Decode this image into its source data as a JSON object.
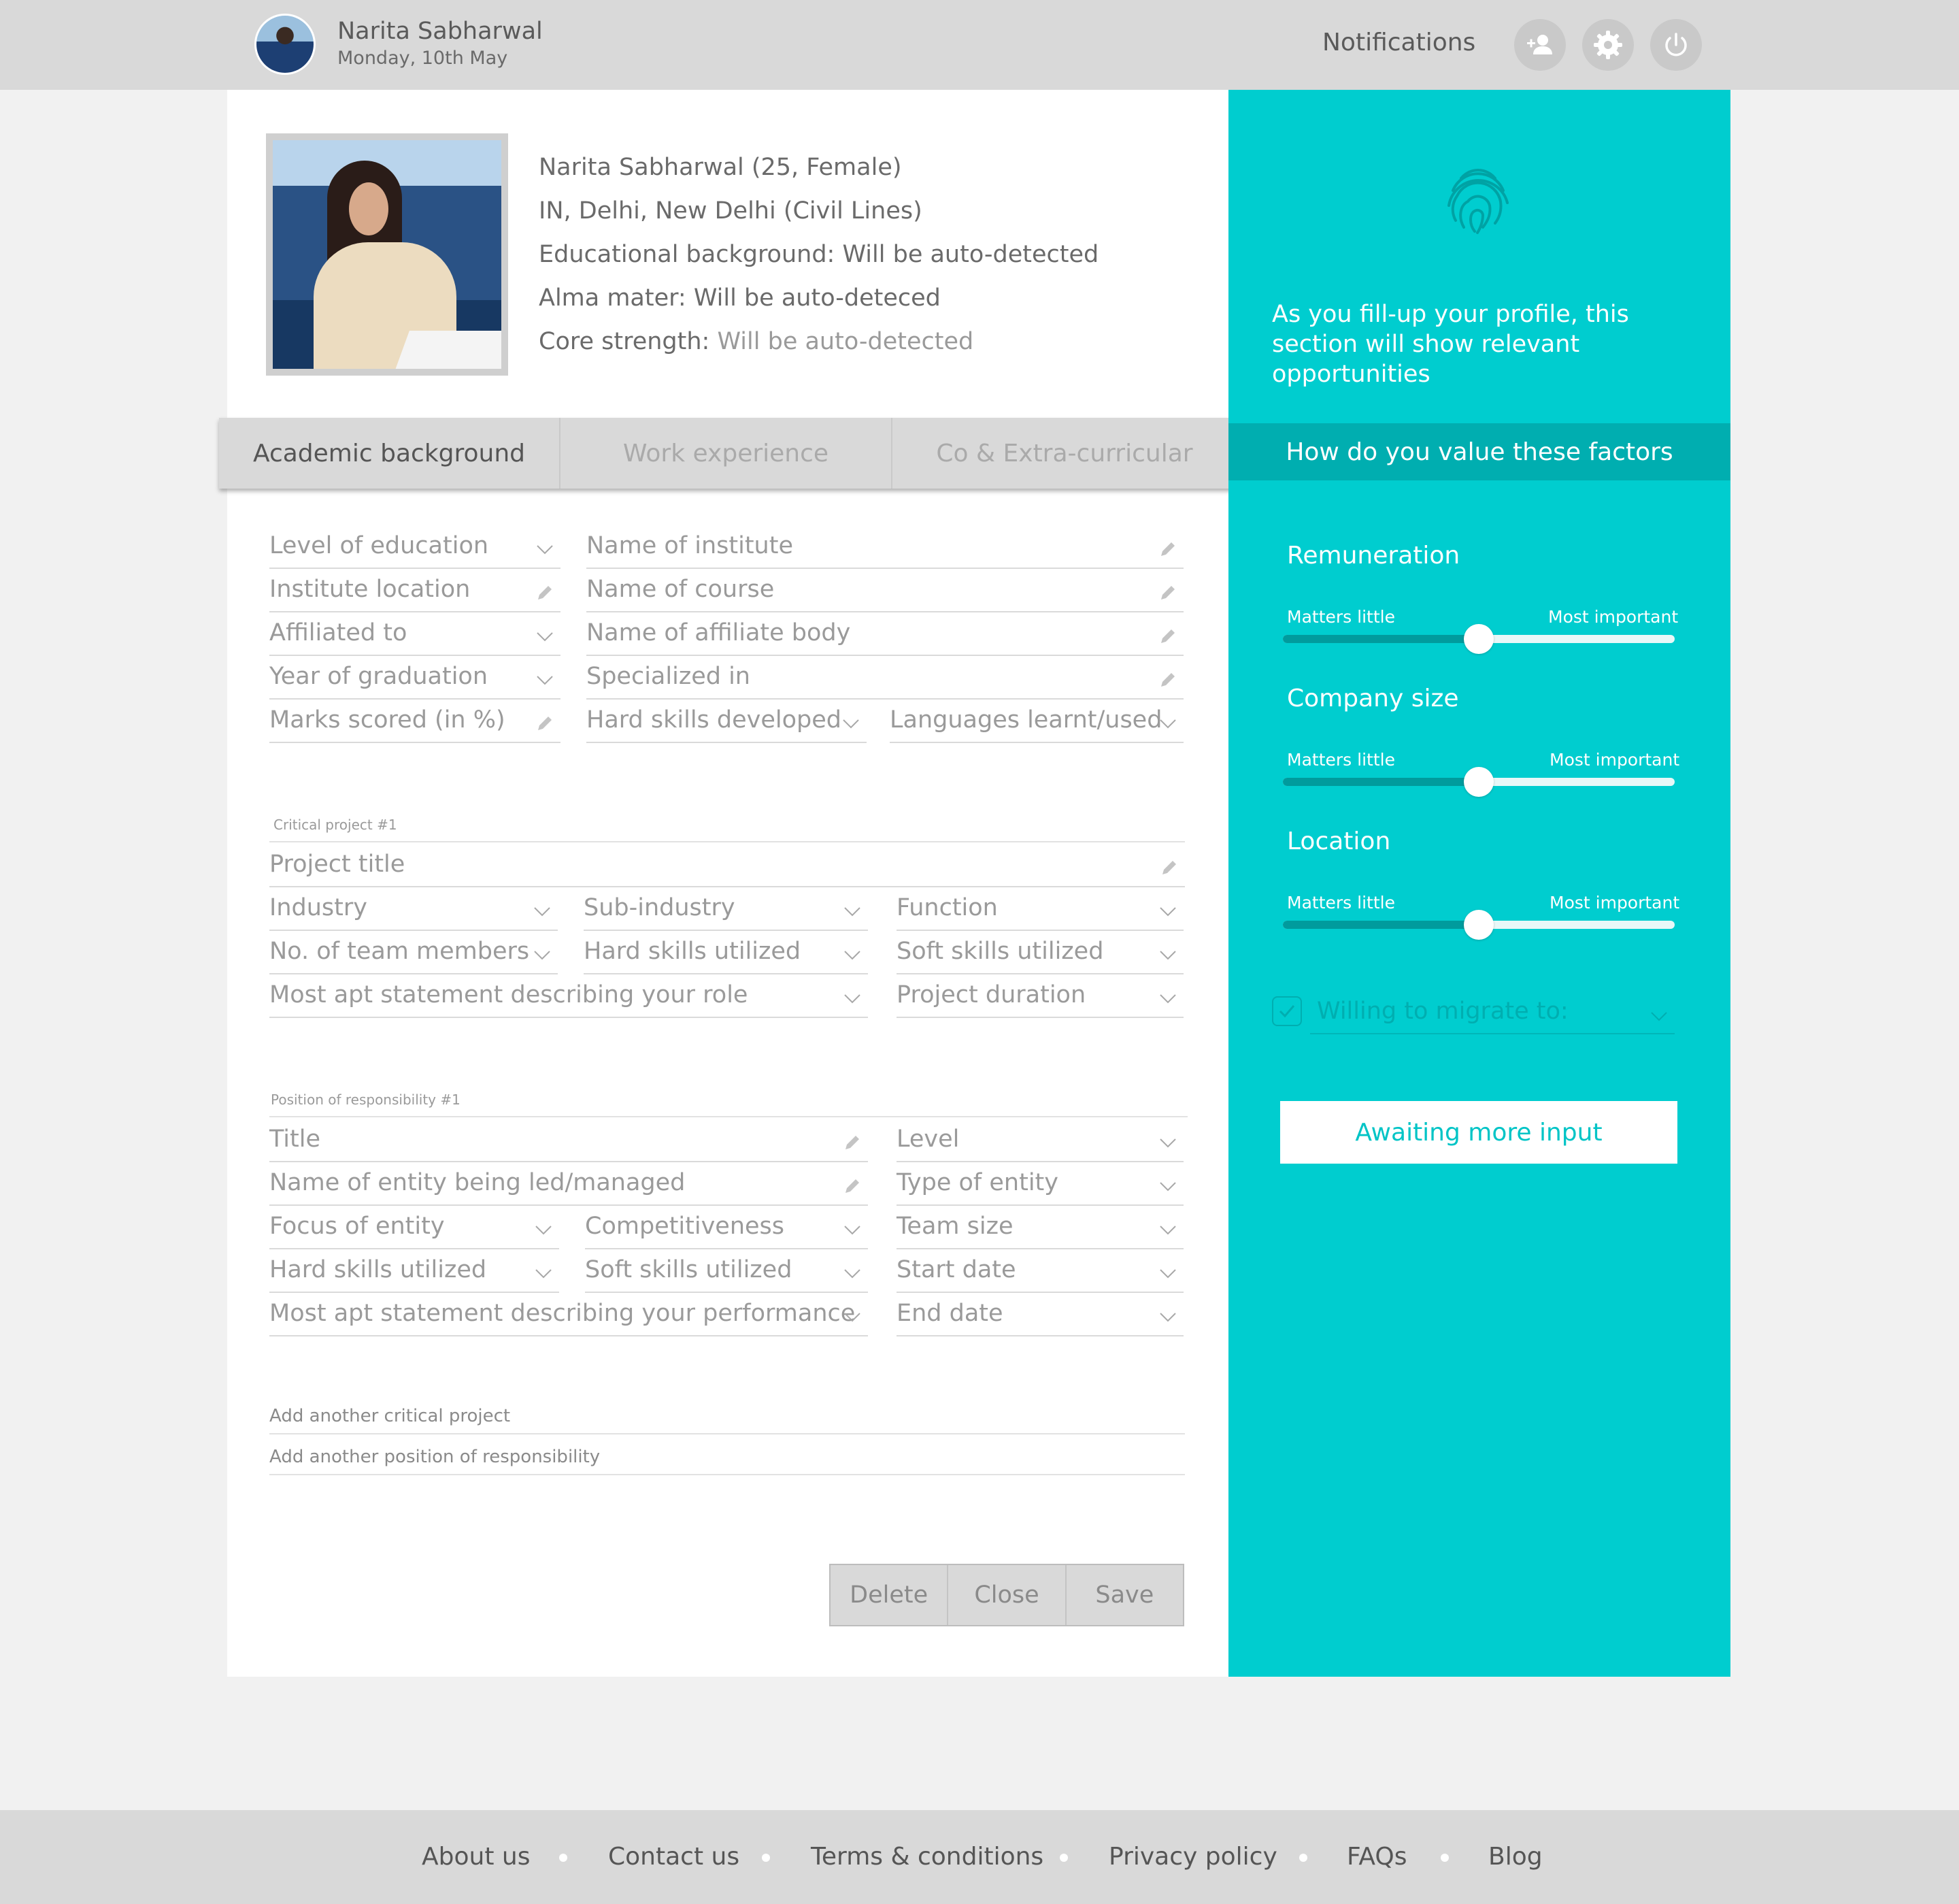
{
  "header": {
    "user_name": "Narita Sabharwal",
    "date": "Monday, 10th May",
    "notifications_label": "Notifications",
    "icons": [
      "add-person-icon",
      "gear-icon",
      "power-icon"
    ]
  },
  "profile": {
    "line1": "Narita Sabharwal (25, Female)",
    "line2": "IN, Delhi, New Delhi (Civil Lines)",
    "line3": "Educational background: Will be auto-detected",
    "line4": "Alma mater: Will be auto-deteced",
    "line5_label": "Core strength: ",
    "line5_value": "Will be auto-detected"
  },
  "tabs": {
    "academic": "Academic background",
    "work": "Work experience",
    "extra": "Co & Extra-curricular"
  },
  "academic": {
    "level_of_education": "Level of education",
    "name_of_institute": "Name of institute",
    "institute_location": "Institute location",
    "name_of_course": "Name of course",
    "affiliated_to": "Affiliated to",
    "name_of_affiliate_body": "Name of affiliate body",
    "year_of_graduation": "Year of graduation",
    "specialized_in": "Specialized in",
    "marks_scored": "Marks scored (in %)",
    "hard_skills_developed": "Hard skills developed",
    "languages": "Languages learnt/used"
  },
  "project": {
    "section_label": "Critical project #1",
    "project_title": "Project title",
    "industry": "Industry",
    "sub_industry": "Sub-industry",
    "function": "Function",
    "team_members": "No. of team members",
    "hard_skills": "Hard skills utilized",
    "soft_skills": "Soft skills utilized",
    "role_statement": "Most apt statement describing your role",
    "duration": "Project duration"
  },
  "position": {
    "section_label": "Position of responsibility #1",
    "title": "Title",
    "level": "Level",
    "entity_name": "Name of entity being led/managed",
    "entity_type": "Type of entity",
    "focus": "Focus of entity",
    "competitiveness": "Competitiveness",
    "team_size": "Team size",
    "hard_skills": "Hard skills utilized",
    "soft_skills": "Soft skills utilized",
    "start_date": "Start date",
    "performance_statement": "Most apt statement describing your performance",
    "end_date": "End date"
  },
  "add_links": {
    "project": "Add another critical project",
    "position": "Add another position of responsibility"
  },
  "buttons": {
    "delete": "Delete",
    "close": "Close",
    "save": "Save"
  },
  "panel": {
    "icon": "fingerprint-icon",
    "message": "As you fill-up your profile, this section will show relevant opportunities",
    "factors_heading": "How do you value these factors",
    "factors": [
      {
        "title": "Remuneration",
        "min_label": "Matters little",
        "max_label": "Most important",
        "value": 0.5
      },
      {
        "title": "Company size",
        "min_label": "Matters little",
        "max_label": "Most important",
        "value": 0.5
      },
      {
        "title": "Location",
        "min_label": "Matters little",
        "max_label": "Most important",
        "value": 0.5
      }
    ],
    "migrate_label": "Willing to migrate to:",
    "migrate_checked": true,
    "await_button": "Awaiting more input"
  },
  "footer": {
    "links": [
      "About us",
      "Contact us",
      "Terms & conditions",
      "Privacy policy",
      "FAQs",
      "Blog"
    ]
  },
  "colors": {
    "accent": "#00cdcf",
    "accent_dark": "#00aeb0",
    "topbar": "#d9d9d9",
    "background": "#f1f1f1"
  }
}
